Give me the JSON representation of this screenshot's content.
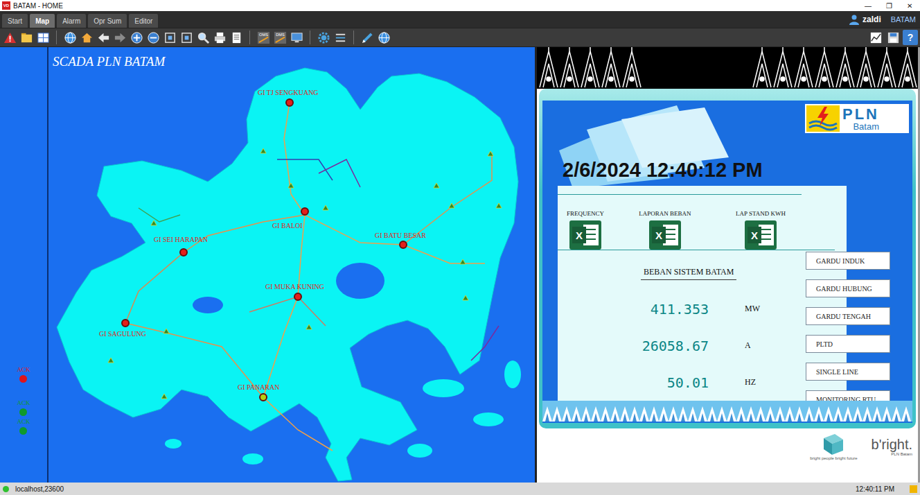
{
  "window": {
    "title": "BATAM - HOME",
    "app_icon": "VD",
    "controls": [
      "—",
      "❐",
      "✕"
    ]
  },
  "tabs": [
    {
      "label": "Start",
      "selected": false
    },
    {
      "label": "Map",
      "selected": true
    },
    {
      "label": "Alarm",
      "selected": false
    },
    {
      "label": "Opr Sum",
      "selected": false
    },
    {
      "label": "Editor",
      "selected": false
    }
  ],
  "user": {
    "name": "zaldi",
    "site": "BATAM"
  },
  "toolbar": {
    "labels": [
      "OMS",
      "DMS"
    ],
    "help": "?"
  },
  "map": {
    "title": "SCADA PLN BATAM",
    "substations": [
      {
        "label": "GI TJ SENGKUANG",
        "color": "#e3201b"
      },
      {
        "label": "GI SEI HARAPAN",
        "color": "#e3201b"
      },
      {
        "label": "GI BALOI",
        "color": "#e3201b"
      },
      {
        "label": "GI BATU BESAR",
        "color": "#e3201b"
      },
      {
        "label": "GI MUKA KUNING",
        "color": "#e3201b"
      },
      {
        "label": "GI SAGULUNG",
        "color": "#e3201b"
      },
      {
        "label": "GI PANARAN",
        "color": "#b5cf12"
      }
    ]
  },
  "ack": [
    {
      "label": "ACK",
      "color": "#e0141b"
    },
    {
      "label": "ACK",
      "color": "#0f9a2c"
    },
    {
      "label": "ACK",
      "color": "#0f9a2c"
    }
  ],
  "dashboard": {
    "logo": {
      "brand": "PLN",
      "region": "Batam"
    },
    "datetime": "2/6/2024 12:40:12 PM",
    "reports": [
      {
        "label": "FREQUENCY",
        "icon_glyph": "X"
      },
      {
        "label": "LAPORAN BEBAN",
        "icon_glyph": "X"
      },
      {
        "label": "LAP STAND KWH",
        "icon_glyph": "X"
      }
    ],
    "load_title": "BEBAN SISTEM BATAM",
    "readings": [
      {
        "value": "411.353",
        "unit": "MW"
      },
      {
        "value": "26058.67",
        "unit": "A"
      },
      {
        "value": "50.01",
        "unit": "HZ"
      }
    ],
    "nav_buttons": [
      "GARDU INDUK",
      "GARDU HUBUNG",
      "GARDU TENGAH",
      "PLTD",
      "SINGLE LINE",
      "MONITORING RTU"
    ],
    "footer_logo": {
      "name": "b'right.",
      "tagline": "bright people bright future",
      "sub": "PLN Batam"
    }
  },
  "status_bar": {
    "connection": "localhost,23600",
    "connected": true,
    "time": "12:40:11 PM"
  }
}
